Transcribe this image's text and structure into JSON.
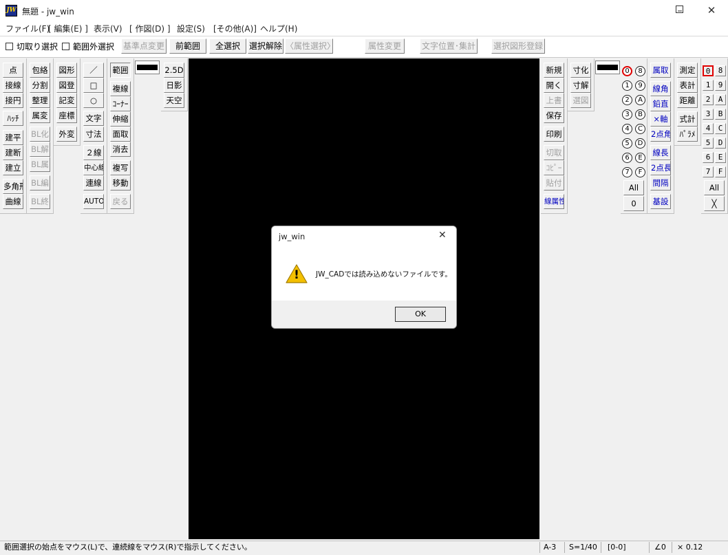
{
  "window": {
    "title": "無題 - jw_win",
    "app_icon_text": "JW",
    "minimize_icon": "–",
    "maximize_icon": "☐",
    "close_icon": "✕"
  },
  "menu": [
    "ファイル(F)",
    "[ 編集(E) ]",
    "表示(V)",
    "[ 作図(D) ]",
    "設定(S)",
    "[その他(A)]",
    "ヘルプ(H)"
  ],
  "toolbar": {
    "checkbox1_label": "切取り選択",
    "checkbox2_label": "範囲外選択",
    "buttons": [
      "基準点変更",
      "前範囲",
      "全選択",
      "選択解除",
      "〈属性選択〉",
      "属性変更",
      "文字位置･集計",
      "選択図形登録"
    ]
  },
  "left_tools": {
    "col1": [
      "点",
      "接線",
      "接円",
      "ﾊｯﾁ",
      "建平",
      "建断",
      "建立",
      "多角形",
      "曲線"
    ],
    "col2": [
      "包絡",
      "分割",
      "整理",
      "属変",
      "BL化",
      "BL解",
      "BL属",
      "BL編",
      "BL終"
    ],
    "col3": [
      "図形",
      "図登",
      "記変",
      "座標",
      "外変"
    ],
    "col4": [
      "／",
      "□",
      "○",
      "文字",
      "寸法",
      "２線",
      "中心線",
      "連線",
      "AUTO"
    ],
    "col5": [
      "範囲",
      "複線",
      "ｺｰﾅｰ",
      "伸縮",
      "面取",
      "消去",
      "複写",
      "移動",
      "戻る"
    ],
    "col6": [
      "2.5D",
      "日影",
      "天空"
    ]
  },
  "right_tools": {
    "file_col": [
      "新規",
      "開く",
      "上書",
      "保存",
      "印刷",
      "切取",
      "ｺﾋﾟｰ",
      "貼付",
      "線属性"
    ],
    "dim_col": [
      "寸化",
      "寸解",
      "選図"
    ],
    "layer_circles": [
      "0",
      "8",
      "1",
      "9",
      "2",
      "A",
      "3",
      "B",
      "4",
      "C",
      "5",
      "D",
      "6",
      "E",
      "7",
      "F"
    ],
    "layer_all": "All",
    "layer_zero": "0",
    "attr_col": [
      "属取",
      "線角",
      "鉛直",
      "×軸",
      "2点角",
      "線長",
      "2点長",
      "間隔",
      "基設"
    ],
    "measure_col": [
      "測定",
      "表計",
      "距離",
      "式計",
      "ﾊﾟﾗﾒ"
    ],
    "group_squares": [
      "0",
      "8",
      "1",
      "9",
      "2",
      "A",
      "3",
      "B",
      "4",
      "C",
      "5",
      "D",
      "6",
      "E",
      "7",
      "F"
    ],
    "group_all": "All",
    "group_x": "╳"
  },
  "dialog": {
    "title": "jw_win",
    "message": "JW_CADでは読み込めないファイルです。",
    "ok_label": "OK",
    "close_icon": "✕",
    "warning_icon": "!"
  },
  "status": {
    "message": "範囲選択の始点をマウス(L)で、連続線をマウス(R)で指示してください。",
    "paper": "A-3",
    "scale": "S=1/40",
    "layer": "[0-0]",
    "angle": "∠0",
    "zoom": "× 0.12"
  },
  "colors": {
    "canvas": "#000000",
    "warning_yellow": "#f3c000",
    "selected_red": "#e00000",
    "blue_label": "#0000c0"
  }
}
